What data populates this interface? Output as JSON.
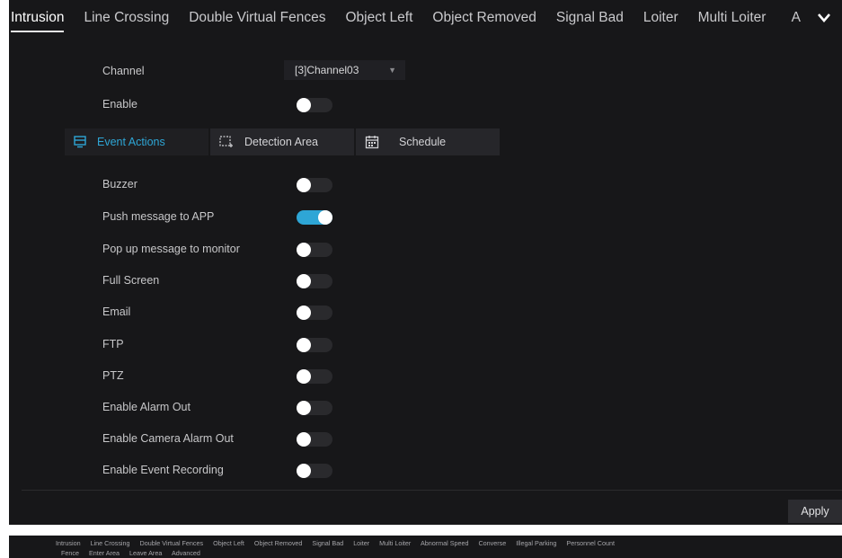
{
  "tabs": [
    "Intrusion",
    "Line Crossing",
    "Double Virtual Fences",
    "Object Left",
    "Object Removed",
    "Signal Bad",
    "Loiter",
    "Multi Loiter"
  ],
  "tab_clipped": "A",
  "active_tab": "Intrusion",
  "channel": {
    "label": "Channel",
    "value": "[3]Channel03"
  },
  "enable": {
    "label": "Enable",
    "on": false
  },
  "subtabs": [
    {
      "label": "Event Actions",
      "icon": "event-actions-icon",
      "active": true
    },
    {
      "label": "Detection Area",
      "icon": "detection-area-icon",
      "active": false
    },
    {
      "label": "Schedule",
      "icon": "calendar-icon",
      "active": false
    }
  ],
  "actions": [
    {
      "label": "Buzzer",
      "on": false
    },
    {
      "label": "Push message to APP",
      "on": true
    },
    {
      "label": "Pop up message to monitor",
      "on": false
    },
    {
      "label": "Full Screen",
      "on": false
    },
    {
      "label": "Email",
      "on": false
    },
    {
      "label": "FTP",
      "on": false
    },
    {
      "label": "PTZ",
      "on": false
    },
    {
      "label": "Enable Alarm Out",
      "on": false
    },
    {
      "label": "Enable Camera Alarm Out",
      "on": false
    },
    {
      "label": "Enable Event Recording",
      "on": false
    }
  ],
  "apply_label": "Apply",
  "bottom_tabs_row1": [
    "Intrusion",
    "Line Crossing",
    "Double Virtual Fences",
    "Object Left",
    "Object Removed",
    "Signal Bad",
    "Loiter",
    "Multi Loiter",
    "Abnormal Speed",
    "Converse",
    "Illegal Parking",
    "Personnel Count"
  ],
  "bottom_tabs_row2": [
    "Fence",
    "Enter Area",
    "Leave Area",
    "Advanced"
  ],
  "colors": {
    "accent": "#2ea6d6",
    "panel_bg": "#171719"
  }
}
